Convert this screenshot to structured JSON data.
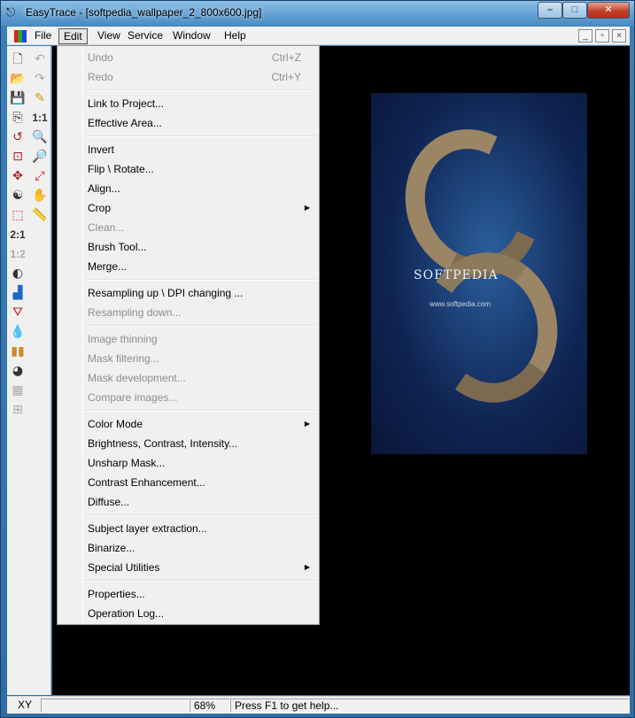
{
  "window": {
    "app_name": "EasyTrace",
    "title": "EasyTrace - [softpedia_wallpaper_2_800x600.jpg]",
    "minimize_glyph": "–",
    "maximize_glyph": "□",
    "close_glyph": "✕"
  },
  "menubar": {
    "items": [
      "File",
      "Edit",
      "View",
      "Service",
      "Window",
      "Help"
    ],
    "active": "Edit",
    "mdi_buttons": [
      "_",
      "▫",
      "×"
    ]
  },
  "edit_menu": {
    "items": [
      {
        "label": "Undo",
        "shortcut": "Ctrl+Z",
        "disabled": true
      },
      {
        "label": "Redo",
        "shortcut": "Ctrl+Y",
        "disabled": true
      },
      {
        "label": "Link to Project...",
        "disabled": false
      },
      {
        "label": "Effective Area...",
        "disabled": false
      },
      {
        "label": "Invert",
        "disabled": false
      },
      {
        "label": "Flip \\ Rotate...",
        "disabled": false
      },
      {
        "label": "Align...",
        "disabled": false
      },
      {
        "label": "Crop",
        "disabled": false,
        "submenu": true
      },
      {
        "label": "Clean...",
        "disabled": true
      },
      {
        "label": "Brush Tool...",
        "disabled": false
      },
      {
        "label": "Merge...",
        "disabled": false
      },
      {
        "label": "Resampling up \\ DPI changing ...",
        "disabled": false
      },
      {
        "label": "Resampling down...",
        "disabled": true
      },
      {
        "label": "Image thinning",
        "disabled": true
      },
      {
        "label": "Mask filtering...",
        "disabled": true
      },
      {
        "label": "Mask development...",
        "disabled": true
      },
      {
        "label": "Compare images...",
        "disabled": true
      },
      {
        "label": "Color Mode",
        "disabled": false,
        "submenu": true
      },
      {
        "label": "Brightness, Contrast, Intensity...",
        "disabled": false
      },
      {
        "label": "Unsharp Mask...",
        "disabled": false
      },
      {
        "label": "Contrast Enhancement...",
        "disabled": false
      },
      {
        "label": "Diffuse...",
        "disabled": false
      },
      {
        "label": "Subject layer extraction...",
        "disabled": false
      },
      {
        "label": "Binarize...",
        "disabled": false
      },
      {
        "label": "Special Utilities",
        "disabled": false,
        "submenu": true
      },
      {
        "label": "Properties...",
        "disabled": false
      },
      {
        "label": "Operation Log...",
        "disabled": false
      }
    ],
    "submenu_arrow": "▶"
  },
  "toolbar": {
    "left_icons": [
      "new-icon",
      "open-icon",
      "save-icon",
      "copy-icon",
      "rotate-icon",
      "fit-icon",
      "transform-icon",
      "yin-yang-icon",
      "selection-rect-icon",
      "ratio-2-1-icon",
      "ratio-1-2-icon",
      "brightness-icon",
      "histogram-icon",
      "filter-icon",
      "drop-icon",
      "color-bars-icon",
      "palette-icon",
      "grid-icon",
      "zoom-grid-icon"
    ],
    "right_icons": [
      "undo-icon",
      "redo-icon",
      "pencil-icon",
      "ratio-1-1-icon",
      "zoom-in-icon",
      "zoom-out-icon",
      "zoom-fit-icon",
      "hand-icon",
      "ruler-icon"
    ],
    "labels": {
      "ratio_2_1": "2:1",
      "ratio_1_2": "1:2",
      "ratio_1_1": "1:1"
    }
  },
  "image": {
    "watermark": "SOFTPEDIA",
    "url": "www.softpedia.com"
  },
  "statusbar": {
    "coords_label": "XY",
    "zoom": "68%",
    "help": "Press F1 to get help..."
  },
  "colors": {
    "title_gradient_top": "#8fbfe4",
    "close_button": "#c2402b",
    "menu_bg": "#f0f0f0",
    "disabled_text": "#8d8d8d",
    "doc_bg": "#000000"
  }
}
